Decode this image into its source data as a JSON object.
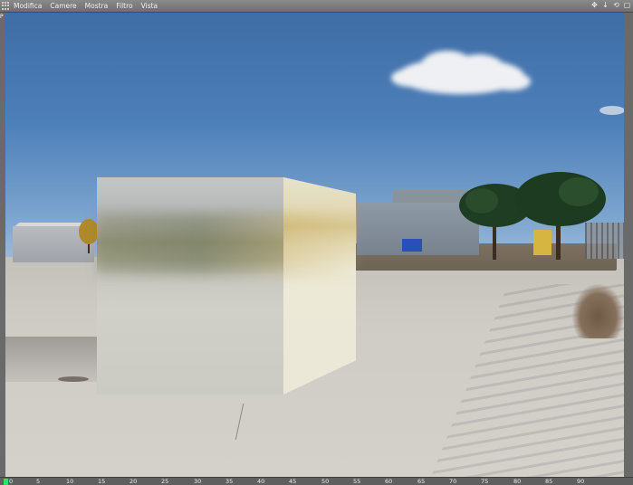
{
  "menubar": {
    "items": [
      {
        "label": "Modifica"
      },
      {
        "label": "Camere"
      },
      {
        "label": "Mostra"
      },
      {
        "label": "Filtro"
      },
      {
        "label": "Vista"
      }
    ],
    "nav_icons": [
      {
        "name": "move-icon",
        "glyph": "✥"
      },
      {
        "name": "zoom-icon",
        "glyph": "↓"
      },
      {
        "name": "rotate-icon",
        "glyph": "⟲"
      },
      {
        "name": "maximize-icon",
        "glyph": "▢"
      }
    ]
  },
  "viewport": {
    "side_label": "P"
  },
  "timeline": {
    "ticks": [
      "0",
      "5",
      "10",
      "15",
      "20",
      "25",
      "30",
      "35",
      "40",
      "45",
      "50",
      "55",
      "60",
      "65",
      "70",
      "75",
      "80",
      "85",
      "90"
    ],
    "current_frame_color": "#2ee06a"
  },
  "colors": {
    "menubar": "#7a7a7a",
    "sky_top": "#3f6da6",
    "sky_bottom": "#9bb9d6",
    "ground": "#cfcbc5"
  }
}
